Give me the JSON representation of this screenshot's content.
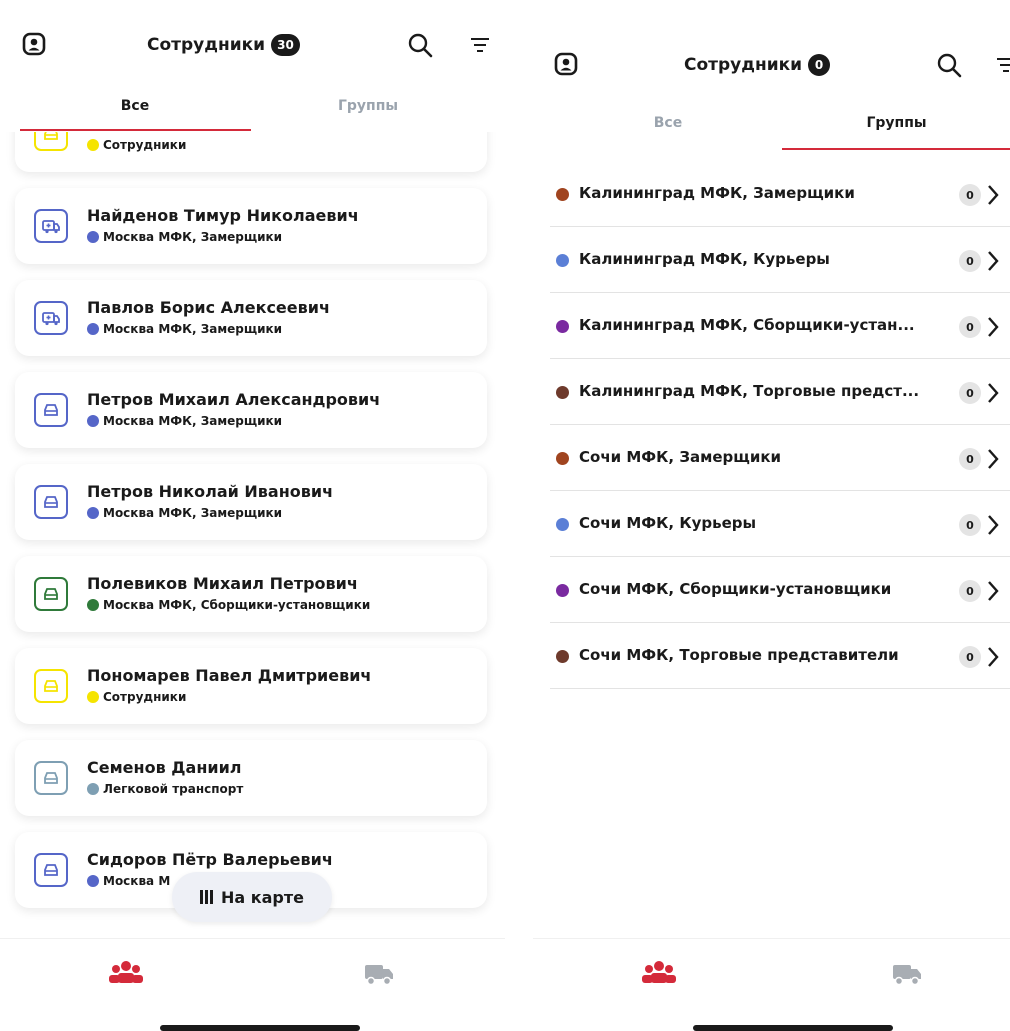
{
  "colors": {
    "accent_red": "#d42a3a",
    "moscow_blue": "#5566c8",
    "green": "#2f7a3a",
    "yellow": "#f5e400",
    "steel": "#7e9fb3"
  },
  "left": {
    "header": {
      "title": "Сотрудники",
      "count": "30",
      "profile_icon": "profile-icon",
      "search_icon": "search-icon",
      "filter_icon": "filter-icon"
    },
    "tabs": [
      {
        "label": "Все",
        "active": true
      },
      {
        "label": "Группы",
        "active": false
      }
    ],
    "employees": [
      {
        "name": "",
        "group": "Сотрудники",
        "icon": "car-icon",
        "color": "#f5e400"
      },
      {
        "name": "Найденов Тимур Николаевич",
        "group": "Москва МФК, Замерщики",
        "icon": "van-icon",
        "color": "#5566c8"
      },
      {
        "name": "Павлов Борис Алексеевич",
        "group": "Москва МФК, Замерщики",
        "icon": "van-icon",
        "color": "#5566c8"
      },
      {
        "name": "Петров Михаил Александрович",
        "group": "Москва МФК, Замерщики",
        "icon": "car-icon",
        "color": "#5566c8"
      },
      {
        "name": "Петров Николай Иванович",
        "group": "Москва МФК, Замерщики",
        "icon": "car-icon",
        "color": "#5566c8"
      },
      {
        "name": "Полевиков Михаил Петрович",
        "group": "Москва МФК, Сборщики-установщики",
        "icon": "car-icon",
        "color": "#2f7a3a"
      },
      {
        "name": "Пономарев Павел Дмитриевич",
        "group": "Сотрудники",
        "icon": "car-icon",
        "color": "#f5e400"
      },
      {
        "name": "Семенов Даниил",
        "group": "Легковой транспорт",
        "icon": "car-icon",
        "color": "#7e9fb3"
      },
      {
        "name": "Сидоров Пётр Валерьевич",
        "group": "Москва М",
        "icon": "car-icon",
        "color": "#5566c8"
      }
    ],
    "map_button": "На карте",
    "bottom_nav": [
      "employees-icon",
      "truck-icon"
    ]
  },
  "right": {
    "header": {
      "title": "Сотрудники",
      "count": "0"
    },
    "tabs": [
      {
        "label": "Все",
        "active": false
      },
      {
        "label": "Группы",
        "active": true
      }
    ],
    "groups": [
      {
        "name": "Калининград МФК, Замерщики",
        "count": "0",
        "color": "#a0441f"
      },
      {
        "name": "Калининград МФК, Курьеры",
        "count": "0",
        "color": "#5b7fd6"
      },
      {
        "name": "Калининград МФК, Сборщики-устан...",
        "count": "0",
        "color": "#7a2aa0"
      },
      {
        "name": "Калининград МФК, Торговые предст...",
        "count": "0",
        "color": "#6e3a2c"
      },
      {
        "name": "Сочи МФК, Замерщики",
        "count": "0",
        "color": "#a0441f"
      },
      {
        "name": "Сочи МФК, Курьеры",
        "count": "0",
        "color": "#5b7fd6"
      },
      {
        "name": "Сочи МФК, Сборщики-установщики",
        "count": "0",
        "color": "#7a2aa0"
      },
      {
        "name": "Сочи МФК, Торговые представители",
        "count": "0",
        "color": "#6e3a2c"
      }
    ]
  }
}
